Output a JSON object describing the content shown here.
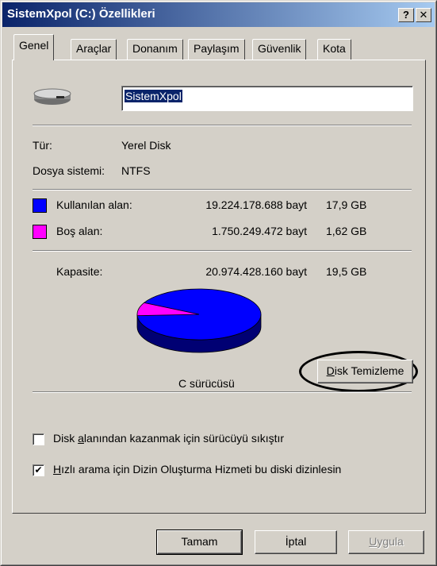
{
  "window": {
    "title": "SistemXpol (C:) Özellikleri",
    "help_btn": "?",
    "close_btn": "✕"
  },
  "tabs": [
    {
      "label": "Genel"
    },
    {
      "label": "Araçlar"
    },
    {
      "label": "Donanım"
    },
    {
      "label": "Paylaşım"
    },
    {
      "label": "Güvenlik"
    },
    {
      "label": "Kota"
    }
  ],
  "drive": {
    "name": "SistemXpol"
  },
  "info": {
    "type_label": "Tür:",
    "type_value": "Yerel Disk",
    "fs_label": "Dosya sistemi:",
    "fs_value": "NTFS"
  },
  "space": {
    "used_label": "Kullanılan alan:",
    "used_bytes": "19.224.178.688 bayt",
    "used_gb": "17,9 GB",
    "used_color": "#0000ff",
    "free_label": "Boş alan:",
    "free_bytes": "1.750.249.472 bayt",
    "free_gb": "1,62 GB",
    "free_color": "#ff00ff",
    "capacity_label": "Kapasite:",
    "capacity_bytes": "20.974.428.160 bayt",
    "capacity_gb": "19,5 GB"
  },
  "chart_data": {
    "type": "pie",
    "categories": [
      "Kullanılan alan",
      "Boş alan"
    ],
    "values": [
      19224178688,
      1750249472
    ],
    "colors": [
      "#0000ff",
      "#ff00ff"
    ]
  },
  "drive_label": "C sürücüsü",
  "disk_cleanup": {
    "pre": "",
    "u": "D",
    "post": "isk Temizleme"
  },
  "options": {
    "compress": {
      "pre": "Disk ",
      "u": "a",
      "post": "lanından kazanmak için sürücüyü sıkıştır",
      "checked": false
    },
    "index": {
      "pre": "",
      "u": "H",
      "post": "ızlı arama için Dizin Oluşturma Hizmeti bu diski dizinlesin",
      "checked": true
    }
  },
  "buttons": {
    "ok": "Tamam",
    "cancel": "İptal",
    "apply_u": "U",
    "apply_rest": "ygula"
  }
}
